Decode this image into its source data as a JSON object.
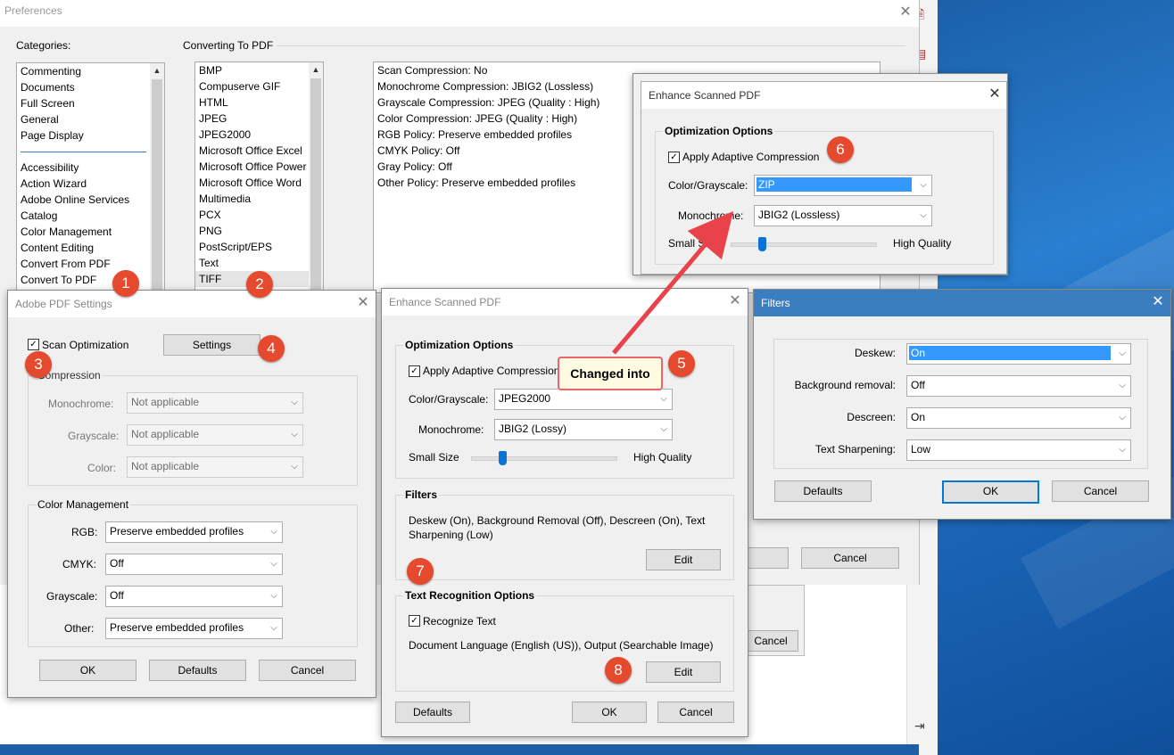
{
  "prefs": {
    "title": "Preferences",
    "categories_label": "Categories:",
    "categories": [
      "Commenting",
      "Documents",
      "Full Screen",
      "General",
      "Page Display"
    ],
    "categories2": [
      "Accessibility",
      "Action Wizard",
      "Adobe Online Services",
      "Catalog",
      "Color Management",
      "Content Editing",
      "Convert From PDF",
      "Convert To PDF"
    ],
    "converting_label": "Converting To PDF",
    "formats": [
      "BMP",
      "Compuserve GIF",
      "HTML",
      "JPEG",
      "JPEG2000",
      "Microsoft Office Excel",
      "Microsoft Office Power",
      "Microsoft Office Word",
      "Multimedia",
      "PCX",
      "PNG",
      "PostScript/EPS",
      "Text",
      "TIFF"
    ],
    "details": [
      "Scan Compression: No",
      "Monochrome Compression: JBIG2 (Lossless)",
      "Grayscale Compression: JPEG (Quality : High)",
      "Color Compression: JPEG (Quality : High)",
      "RGB Policy: Preserve embedded profiles",
      "CMYK Policy: Off",
      "Gray Policy: Off",
      "Other Policy: Preserve embedded profiles"
    ],
    "cancel_label": "Cancel",
    "cancel2_label": "Cancel"
  },
  "adobe_settings": {
    "title": "Adobe PDF Settings",
    "scan_optimization": "Scan Optimization",
    "settings_button": "Settings",
    "compression_label": "Compression",
    "monochrome_label": "Monochrome:",
    "grayscale_label": "Grayscale:",
    "color_label": "Color:",
    "not_applicable": "Not applicable",
    "color_mgmt_label": "Color Management",
    "rgb_label": "RGB:",
    "cmyk_label": "CMYK:",
    "gray_label": "Grayscale:",
    "other_label": "Other:",
    "rgb_value": "Preserve embedded profiles",
    "cmyk_value": "Off",
    "gray_value": "Off",
    "other_value": "Preserve embedded profiles",
    "ok": "OK",
    "defaults": "Defaults",
    "cancel": "Cancel"
  },
  "enhance_main": {
    "title": "Enhance Scanned PDF",
    "opt_label": "Optimization Options",
    "apply_adaptive": "Apply Adaptive Compression",
    "color_gray_label": "Color/Grayscale:",
    "color_gray_value": "JPEG2000",
    "mono_label": "Monochrome:",
    "mono_value": "JBIG2 (Lossy)",
    "small_size": "Small Size",
    "high_quality": "High Quality",
    "slider_level": 0.25,
    "filters_label": "Filters",
    "filters_text": "Deskew (On), Background Removal (Off), Descreen (On), Text Sharpening (Low)",
    "edit": "Edit",
    "text_rec_label": "Text Recognition Options",
    "recognize_text": "Recognize Text",
    "doc_lang": "Document Language (English (US)), Output (Searchable Image)",
    "edit2": "Edit",
    "defaults": "Defaults",
    "ok": "OK",
    "cancel": "Cancel"
  },
  "enhance_top": {
    "title": "Enhance Scanned PDF",
    "opt_label": "Optimization Options",
    "apply_adaptive": "Apply Adaptive Compression",
    "color_gray_label": "Color/Grayscale:",
    "color_gray_value": "ZIP",
    "mono_label": "Monochrome:",
    "mono_value": "JBIG2 (Lossless)",
    "small_size": "Small Size",
    "high_quality": "High Quality",
    "slider_level": 0.25
  },
  "filters": {
    "title": "Filters",
    "deskew_label": "Deskew:",
    "deskew_value": "On",
    "bg_label": "Background removal:",
    "bg_value": "Off",
    "descreen_label": "Descreen:",
    "descreen_value": "On",
    "sharpen_label": "Text Sharpening:",
    "sharpen_value": "Low",
    "defaults": "Defaults",
    "ok": "OK",
    "cancel": "Cancel"
  },
  "annotations": {
    "b1": "1",
    "b2": "2",
    "b3": "3",
    "b4": "4",
    "b5": "5",
    "b6": "6",
    "b7": "7",
    "b8": "8",
    "callout": "Changed into",
    "accent": "#e64a2e",
    "arrow_color": "#e8434a"
  }
}
